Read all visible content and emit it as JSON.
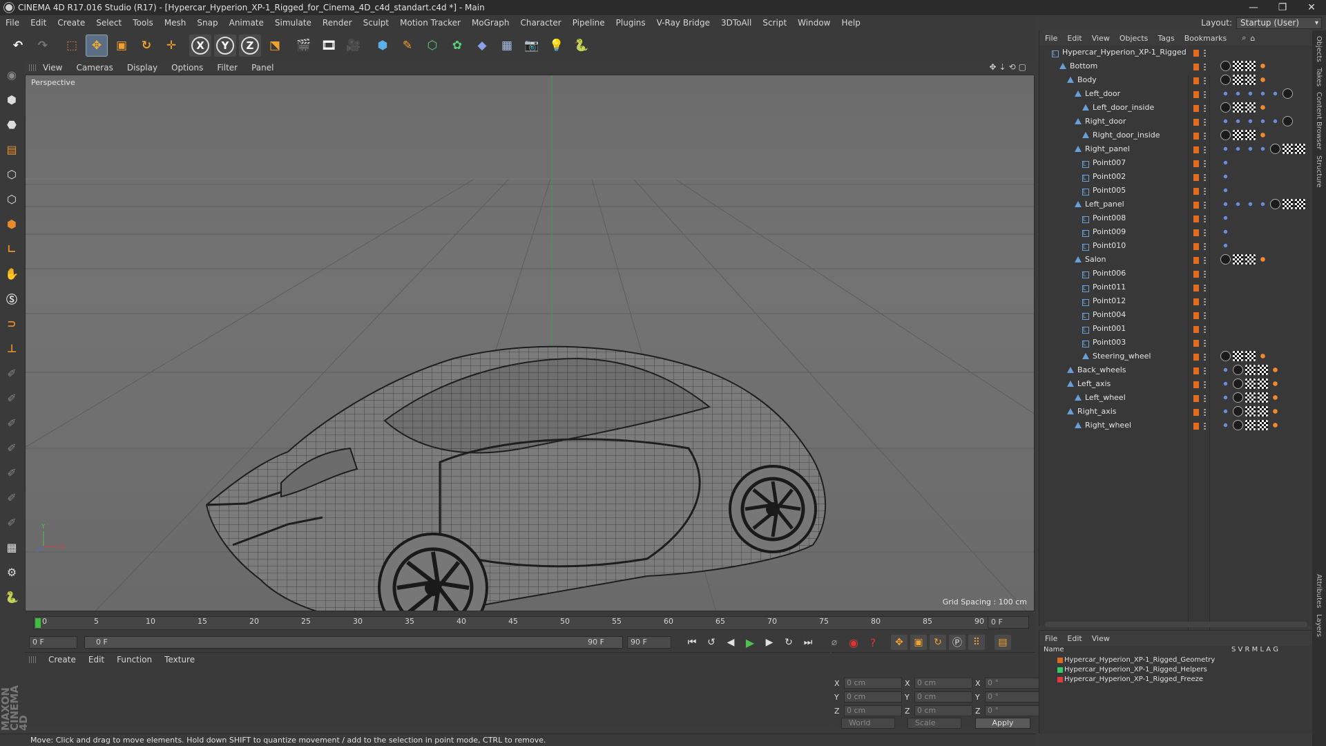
{
  "window": {
    "title": "CINEMA 4D R17.016 Studio (R17) - [Hypercar_Hyperion_XP-1_Rigged_for_Cinema_4D_c4d_standart.c4d *] - Main",
    "controls": [
      "—",
      "❐",
      "✕"
    ]
  },
  "menu": [
    "File",
    "Edit",
    "Create",
    "Select",
    "Tools",
    "Mesh",
    "Snap",
    "Animate",
    "Simulate",
    "Render",
    "Sculpt",
    "Motion Tracker",
    "MoGraph",
    "Character",
    "Pipeline",
    "Plugins",
    "V-Ray Bridge",
    "3DToAll",
    "Script",
    "Window",
    "Help"
  ],
  "layout": {
    "label": "Layout:",
    "value": "Startup (User)"
  },
  "viewport": {
    "menu": [
      "View",
      "Cameras",
      "Display",
      "Options",
      "Filter",
      "Panel"
    ],
    "camera_label": "Perspective",
    "grid_spacing": "Grid Spacing : 100 cm"
  },
  "timeline": {
    "ticks": [
      "0",
      "5",
      "10",
      "15",
      "20",
      "25",
      "30",
      "35",
      "40",
      "45",
      "50",
      "55",
      "60",
      "65",
      "70",
      "75",
      "80",
      "85",
      "90"
    ],
    "current_frame_right": "0 F",
    "start_field": "0 F",
    "range_start": "0 F",
    "range_end": "90 F",
    "end_field": "90 F"
  },
  "material_manager": {
    "menu": [
      "Create",
      "Edit",
      "Function",
      "Texture"
    ]
  },
  "coordinates": {
    "rows": [
      {
        "a": "X",
        "av": "0 cm",
        "b": "X",
        "bv": "0 cm",
        "c": "X",
        "cv": "0 °"
      },
      {
        "a": "Y",
        "av": "0 cm",
        "b": "Y",
        "bv": "0 cm",
        "c": "Y",
        "cv": "0 °"
      },
      {
        "a": "Z",
        "av": "0 cm",
        "b": "Z",
        "bv": "0 cm",
        "c": "Z",
        "cv": "0 °"
      }
    ],
    "mode": "World",
    "scale": "Scale",
    "apply": "Apply"
  },
  "status": "Move: Click and drag to move elements. Hold down SHIFT to quantize movement / add to the selection in point mode, CTRL to remove.",
  "brand": "MAXON CINEMA 4D",
  "object_manager": {
    "menu": [
      "File",
      "Edit",
      "View",
      "Objects",
      "Tags",
      "Bookmarks"
    ],
    "objects": [
      {
        "name": "Hypercar_Hyperion_XP-1_Rigged",
        "indent": 0,
        "icon": "null",
        "tags": []
      },
      {
        "name": "Bottom",
        "indent": 1,
        "icon": "bone",
        "tags": [
          "bl",
          "cb",
          "cb",
          "ik"
        ]
      },
      {
        "name": "Body",
        "indent": 2,
        "icon": "bone",
        "tags": [
          "bl",
          "cb",
          "cb",
          "ik"
        ]
      },
      {
        "name": "Left_door",
        "indent": 3,
        "icon": "bone",
        "tags": [
          "xp",
          "xp",
          "xp",
          "xp",
          "xp",
          "bl"
        ]
      },
      {
        "name": "Left_door_inside",
        "indent": 4,
        "icon": "bone",
        "tags": [
          "bl",
          "cb",
          "cb",
          "ik"
        ]
      },
      {
        "name": "Right_door",
        "indent": 3,
        "icon": "bone",
        "tags": [
          "xp",
          "xp",
          "xp",
          "xp",
          "xp",
          "bl"
        ]
      },
      {
        "name": "Right_door_inside",
        "indent": 4,
        "icon": "bone",
        "tags": [
          "bl",
          "cb",
          "cb",
          "ik"
        ]
      },
      {
        "name": "Right_panel",
        "indent": 3,
        "icon": "bone",
        "tags": [
          "xp",
          "xp",
          "xp",
          "xp",
          "bl",
          "cb",
          "cb"
        ]
      },
      {
        "name": "Point007",
        "indent": 4,
        "icon": "null",
        "tags": [
          "xp"
        ]
      },
      {
        "name": "Point002",
        "indent": 4,
        "icon": "null",
        "tags": [
          "xp"
        ]
      },
      {
        "name": "Point005",
        "indent": 4,
        "icon": "null",
        "tags": [
          "xp"
        ]
      },
      {
        "name": "Left_panel",
        "indent": 3,
        "icon": "bone",
        "tags": [
          "xp",
          "xp",
          "xp",
          "xp",
          "bl",
          "cb",
          "cb"
        ]
      },
      {
        "name": "Point008",
        "indent": 4,
        "icon": "null",
        "tags": [
          "xp"
        ]
      },
      {
        "name": "Point009",
        "indent": 4,
        "icon": "null",
        "tags": [
          "xp"
        ]
      },
      {
        "name": "Point010",
        "indent": 4,
        "icon": "null",
        "tags": [
          "xp"
        ]
      },
      {
        "name": "Salon",
        "indent": 3,
        "icon": "bone",
        "tags": [
          "bl",
          "cb",
          "cb",
          "ik"
        ]
      },
      {
        "name": "Point006",
        "indent": 4,
        "icon": "null",
        "tags": []
      },
      {
        "name": "Point011",
        "indent": 4,
        "icon": "null",
        "tags": []
      },
      {
        "name": "Point012",
        "indent": 4,
        "icon": "null",
        "tags": []
      },
      {
        "name": "Point004",
        "indent": 4,
        "icon": "null",
        "tags": []
      },
      {
        "name": "Point001",
        "indent": 4,
        "icon": "null",
        "tags": []
      },
      {
        "name": "Point003",
        "indent": 4,
        "icon": "null",
        "tags": []
      },
      {
        "name": "Steering_wheel",
        "indent": 4,
        "icon": "bone",
        "tags": [
          "bl",
          "cb",
          "cb",
          "ik"
        ]
      },
      {
        "name": "Back_wheels",
        "indent": 2,
        "icon": "bone",
        "tags": [
          "xp",
          "bl",
          "cb",
          "cb",
          "ik"
        ]
      },
      {
        "name": "Left_axis",
        "indent": 2,
        "icon": "bone",
        "tags": [
          "xp",
          "bl",
          "cb",
          "cb",
          "ik"
        ]
      },
      {
        "name": "Left_wheel",
        "indent": 3,
        "icon": "bone",
        "tags": [
          "xp",
          "bl",
          "cb",
          "cb",
          "ik"
        ]
      },
      {
        "name": "Right_axis",
        "indent": 2,
        "icon": "bone",
        "tags": [
          "xp",
          "bl",
          "cb",
          "cb",
          "ik"
        ]
      },
      {
        "name": "Right_wheel",
        "indent": 3,
        "icon": "bone",
        "tags": [
          "xp",
          "bl",
          "cb",
          "cb",
          "ik"
        ]
      }
    ]
  },
  "layer_manager": {
    "menu": [
      "File",
      "Edit",
      "View"
    ],
    "header": {
      "name": "Name",
      "cols": "S V R M L A G"
    },
    "layers": [
      {
        "name": "Hypercar_Hyperion_XP-1_Rigged_Geometry",
        "color": "#d86b1e"
      },
      {
        "name": "Hypercar_Hyperion_XP-1_Rigged_Helpers",
        "color": "#2fcf63"
      },
      {
        "name": "Hypercar_Hyperion_XP-1_Rigged_Freeze",
        "color": "#e23a3a"
      }
    ]
  },
  "side_tabs": [
    "Objects",
    "Takes",
    "Content Browser",
    "Structure",
    "Attributes",
    "Layers"
  ]
}
